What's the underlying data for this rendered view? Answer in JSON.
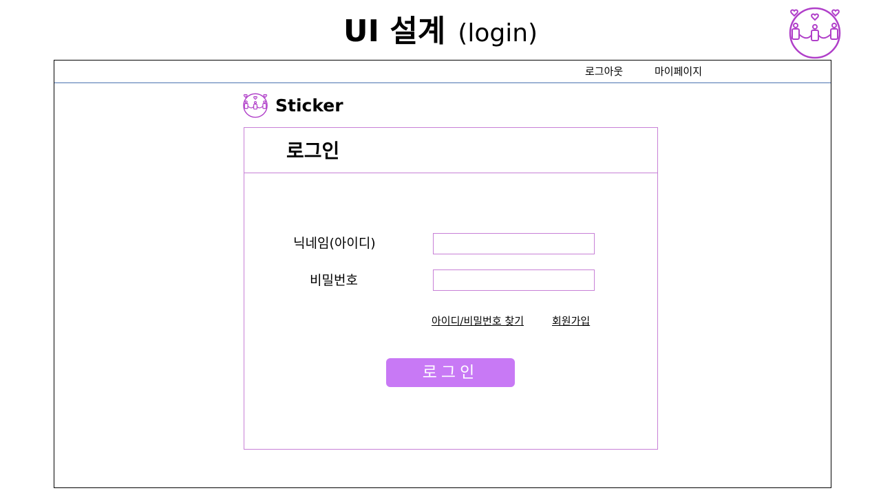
{
  "slide": {
    "title_main": "UI 설계",
    "title_sub": "(login)"
  },
  "topnav": {
    "logout": "로그아웃",
    "mypage": "마이페이지"
  },
  "brand": {
    "name": "Sticker",
    "logo_icon": "people-hearts-icon"
  },
  "login": {
    "title": "로그인",
    "id_label": "닉네임(아이디)",
    "id_value": "",
    "pw_label": "비밀번호",
    "pw_value": "",
    "find_link": "아이디/비밀번호 찾기",
    "signup_link": "회원가입",
    "submit_label": "로그인"
  },
  "colors": {
    "accent": "#c879f5",
    "card_border": "#c77fd6",
    "logo": "#b03fc9",
    "topbar_divider": "#4a72b0"
  }
}
